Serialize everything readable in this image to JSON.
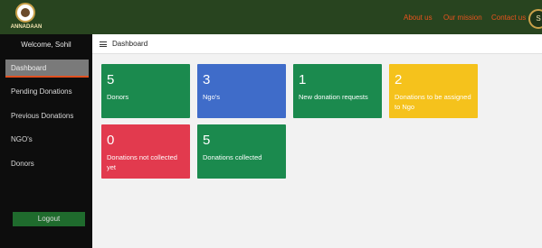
{
  "brand": {
    "logo_text": "ANNADAAN"
  },
  "nav": {
    "links": [
      "About us",
      "Our mission",
      "Contact us"
    ],
    "avatar_initial": "S"
  },
  "sidebar": {
    "welcome": "Welcome, Sohil",
    "items": [
      {
        "label": "Dashboard",
        "active": true
      },
      {
        "label": "Pending Donations",
        "active": false
      },
      {
        "label": "Previous Donations",
        "active": false
      },
      {
        "label": "NGO's",
        "active": false
      },
      {
        "label": "Donors",
        "active": false
      }
    ],
    "logout_label": "Logout"
  },
  "header": {
    "title": "Dashboard"
  },
  "cards": [
    {
      "value": "5",
      "label": "Donors",
      "color": "#1b8a4e"
    },
    {
      "value": "3",
      "label": "Ngo's",
      "color": "#3f6cc9"
    },
    {
      "value": "1",
      "label": "New donation requests",
      "color": "#1b8a4e"
    },
    {
      "value": "2",
      "label": "Donations to be assigned to Ngo",
      "color": "#f5c21c"
    },
    {
      "value": "0",
      "label": "Donations not collected yet",
      "color": "#e23a4e"
    },
    {
      "value": "5",
      "label": "Donations collected",
      "color": "#1b8a4e"
    }
  ]
}
